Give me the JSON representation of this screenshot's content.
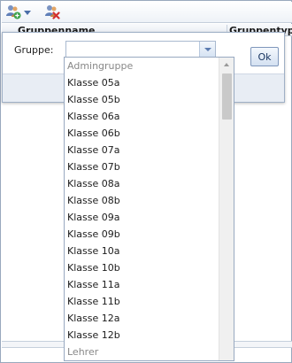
{
  "toolbar": {
    "add_icon": "add-group-icon",
    "delete_icon": "delete-group-icon"
  },
  "grid": {
    "columns": [
      "Gruppenname",
      "Gruppentyp"
    ]
  },
  "dialog": {
    "label": "Gruppe:",
    "combo_value": "",
    "ok_label": "Ok"
  },
  "dropdown": {
    "items": [
      {
        "label": "Admingruppe",
        "kind": "header"
      },
      {
        "label": "Klasse 05a",
        "kind": "item"
      },
      {
        "label": "Klasse 05b",
        "kind": "item"
      },
      {
        "label": "Klasse 06a",
        "kind": "item"
      },
      {
        "label": "Klasse 06b",
        "kind": "item"
      },
      {
        "label": "Klasse 07a",
        "kind": "item"
      },
      {
        "label": "Klasse 07b",
        "kind": "item"
      },
      {
        "label": "Klasse 08a",
        "kind": "item"
      },
      {
        "label": "Klasse 08b",
        "kind": "item"
      },
      {
        "label": "Klasse 09a",
        "kind": "item"
      },
      {
        "label": "Klasse 09b",
        "kind": "item"
      },
      {
        "label": "Klasse 10a",
        "kind": "item"
      },
      {
        "label": "Klasse 10b",
        "kind": "item"
      },
      {
        "label": "Klasse 11a",
        "kind": "item"
      },
      {
        "label": "Klasse 11b",
        "kind": "item"
      },
      {
        "label": "Klasse 12a",
        "kind": "item"
      },
      {
        "label": "Klasse 12b",
        "kind": "item"
      },
      {
        "label": "Lehrer",
        "kind": "header"
      }
    ]
  },
  "colors": {
    "accent": "#4b6ea8",
    "header_item": "#888888"
  }
}
